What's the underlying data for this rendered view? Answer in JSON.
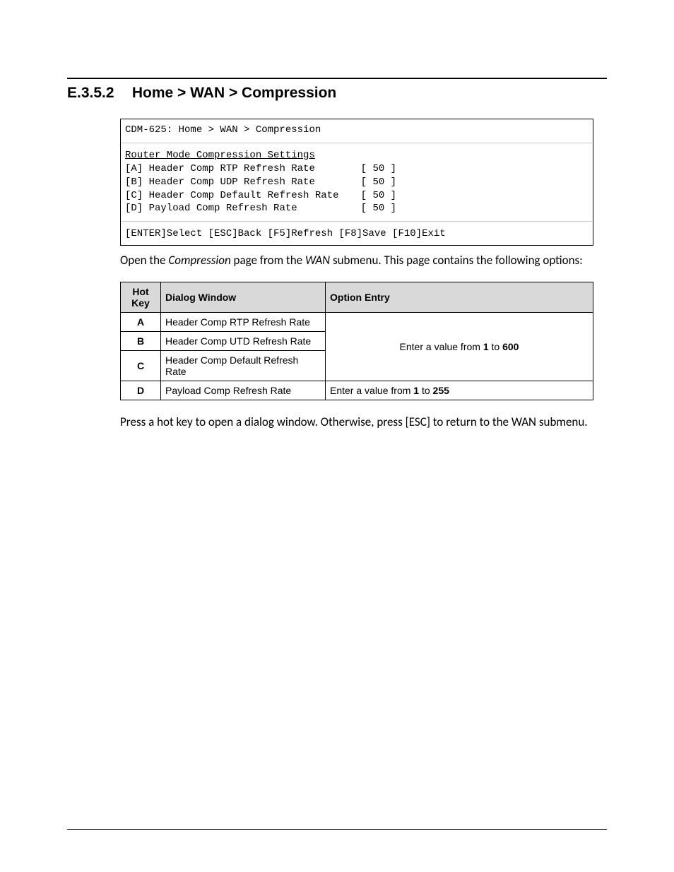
{
  "heading": {
    "number": "E.3.5.2",
    "title": "Home > WAN > Compression"
  },
  "terminal": {
    "breadcrumb": "CDM-625: Home > WAN > Compression",
    "section_title": "Router Mode Compression Settings",
    "rows": [
      {
        "key": "[A]",
        "label": "Header Comp RTP Refresh Rate",
        "value": "50"
      },
      {
        "key": "[B]",
        "label": "Header Comp UDP Refresh Rate",
        "value": "50"
      },
      {
        "key": "[C]",
        "label": "Header Comp Default Refresh Rate",
        "value": "50"
      },
      {
        "key": "[D]",
        "label": "Payload Comp Refresh Rate",
        "value": "50"
      }
    ],
    "footer": "[ENTER]Select [ESC]Back [F5]Refresh [F8]Save [F10]Exit"
  },
  "intro": {
    "t1": "Open the ",
    "compression": "Compression",
    "t2": " page from the ",
    "wan": "WAN",
    "t3": " submenu. This page contains the following options:"
  },
  "table": {
    "headers": {
      "hotkey": "Hot Key",
      "dialog": "Dialog Window",
      "entry": "Option Entry"
    },
    "merged_entry": {
      "p1": "Enter a value from ",
      "b1": "1",
      "p2": " to ",
      "b2": "600"
    },
    "row_d_entry": {
      "p1": "Enter a value from ",
      "b1": "1",
      "p2": " to ",
      "b2": "255"
    },
    "rows": [
      {
        "hotkey": "A",
        "dialog": "Header Comp RTP Refresh Rate"
      },
      {
        "hotkey": "B",
        "dialog": "Header Comp UTD Refresh Rate"
      },
      {
        "hotkey": "C",
        "dialog": "Header Comp Default Refresh Rate"
      },
      {
        "hotkey": "D",
        "dialog": "Payload Comp Refresh Rate"
      }
    ]
  },
  "outro": {
    "t1": "Press a hot key to open a dialog window. Otherwise, press ",
    "esc": "[ESC]",
    "t2": " to return to the ",
    "wan": "WAN",
    "t3": " submenu."
  }
}
